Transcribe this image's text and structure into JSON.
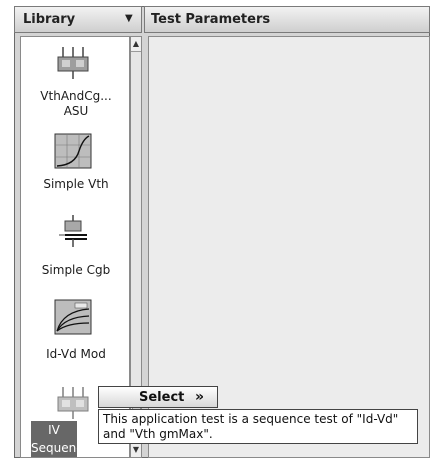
{
  "library": {
    "title": "Library",
    "items": [
      {
        "label": "VthAndCg...\nASU",
        "icon": "circuit-icon"
      },
      {
        "label": "Simple Vth",
        "icon": "plot-curve-icon"
      },
      {
        "label": "Simple Cgb",
        "icon": "capacitor-icon"
      },
      {
        "label": "Id-Vd Mod",
        "icon": "plot-family-icon"
      },
      {
        "label": "IV\nSequence",
        "icon": "circuit-icon"
      }
    ]
  },
  "test_parameters": {
    "title": "Test Parameters"
  },
  "select_button": {
    "label": "Select"
  },
  "tooltip": {
    "text": "This application test is a sequence test of \"Id-Vd\" and \"Vth gmMax\"."
  },
  "colors": {
    "selected": "#676767",
    "panel": "#ececec"
  }
}
